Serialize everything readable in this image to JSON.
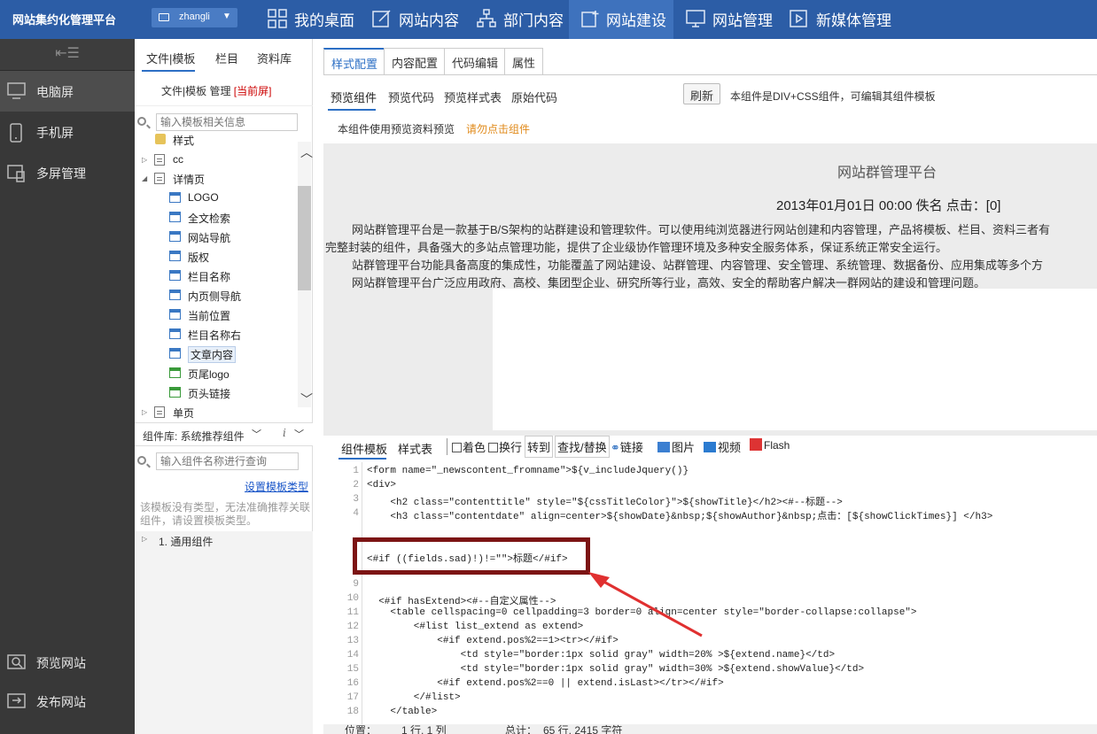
{
  "brand": "网站集约化管理平台",
  "user": {
    "name": "zhangli"
  },
  "nav": [
    {
      "label": "我的桌面",
      "icon": "grid-icon"
    },
    {
      "label": "网站内容",
      "icon": "edit-icon"
    },
    {
      "label": "部门内容",
      "icon": "org-icon"
    },
    {
      "label": "网站建设",
      "icon": "build-icon"
    },
    {
      "label": "网站管理",
      "icon": "monitor-icon"
    },
    {
      "label": "新媒体管理",
      "icon": "media-icon"
    }
  ],
  "leftbar": {
    "items": [
      {
        "label": "电脑屏"
      },
      {
        "label": "手机屏"
      },
      {
        "label": "多屏管理"
      }
    ],
    "bottom": [
      {
        "label": "预览网站"
      },
      {
        "label": "发布网站"
      }
    ]
  },
  "tree": {
    "tabs": [
      "文件|模板",
      "栏目",
      "资料库"
    ],
    "header": "文件|模板 管理",
    "current": "[当前屏]",
    "search_placeholder": "输入模板相关信息",
    "nodes": [
      {
        "label": "样式"
      },
      {
        "label": "cc"
      },
      {
        "label": "详情页"
      },
      {
        "label": "LOGO"
      },
      {
        "label": "全文检索"
      },
      {
        "label": "网站导航"
      },
      {
        "label": "版权"
      },
      {
        "label": "栏目名称"
      },
      {
        "label": "内页侧导航"
      },
      {
        "label": "当前位置"
      },
      {
        "label": "栏目名称右"
      },
      {
        "label": "文章内容"
      },
      {
        "label": "页尾logo"
      },
      {
        "label": "页头链接"
      },
      {
        "label": "单页"
      }
    ]
  },
  "components": {
    "header": "组件库: 系统推荐组件",
    "search_placeholder": "输入组件名称进行查询",
    "link": "设置模板类型",
    "note": "该模板没有类型，无法准确推荐关联组件，请设置模板类型。",
    "group": "1.  通用组件"
  },
  "main": {
    "tabs": [
      "样式配置",
      "内容配置",
      "代码编辑",
      "属性"
    ],
    "subtabs": [
      "预览组件",
      "预览代码",
      "预览样式表",
      "原始代码"
    ],
    "refresh": "刷新",
    "info": "本组件是DIV+CSS组件，可编辑其组件模板",
    "preview_note": "本组件使用预览资料预览",
    "preview_warn": "请勿点击组件",
    "preview": {
      "title": "网站群管理平台",
      "date": "2013年01月01日 00:00 佚名 点击：[0]",
      "p1a": "网站群管理平台是一款基于B/S架构的站群建设和管理软件。可以使用纯浏览器进行网站创建和内容管理，产品将模板、栏目、资料三者有",
      "p1b": "完整封装的组件，具备强大的多站点管理功能，提供了企业级协作管理环境及多种安全服务体系，保证系统正常安全运行。",
      "p2": "站群管理平台功能具备高度的集成性，功能覆盖了网站建设、站群管理、内容管理、安全管理、系统管理、数据备份、应用集成等多个方",
      "p3": "网站群管理平台广泛应用政府、高校、集团型企业、研究所等行业，高效、安全的帮助客户解决一群网站的建设和管理问题。"
    },
    "toolbar": {
      "t1": "组件模板",
      "t2": "样式表",
      "c1": "着色",
      "c2": "换行",
      "b1": "转到",
      "b2": "查找/替换",
      "b3": "链接",
      "b4": "图片",
      "b5": "视频",
      "b6": "Flash"
    },
    "code": [
      {
        "n": "1",
        "t": "<form name=\"_newscontent_fromname\">${v_includeJquery()}"
      },
      {
        "n": "2",
        "t": "<div>"
      },
      {
        "n": "3",
        "t": "    <h2 class=\"contenttitle\" style=\"${cssTitleColor}\">${showTitle}</h2><#--标题-->"
      },
      {
        "n": "4",
        "t": "    <h3 class=\"contentdate\" align=center>${showDate}&nbsp;${showAuthor}&nbsp;点击：[${showClickTimes}] </h3>"
      },
      {
        "n": "",
        "t": ""
      },
      {
        "n": "",
        "t": "<#if ((fields.sad)!)!=\"\">标题</#if>"
      },
      {
        "n": "9",
        "t": ""
      },
      {
        "n": "10",
        "t": "  <#if hasExtend><#--自定义属性-->"
      },
      {
        "n": "11",
        "t": "    <table cellspacing=0 cellpadding=3 border=0 align=center style=\"border-collapse:collapse\">"
      },
      {
        "n": "12",
        "t": "        <#list list_extend as extend>"
      },
      {
        "n": "13",
        "t": "            <#if extend.pos%2==1><tr></#if>"
      },
      {
        "n": "14",
        "t": "                <td style=\"border:1px solid gray\" width=20% >${extend.name}</td>"
      },
      {
        "n": "15",
        "t": "                <td style=\"border:1px solid gray\" width=30% >${extend.showValue}</td>"
      },
      {
        "n": "16",
        "t": "            <#if extend.pos%2==0 || extend.isLast></tr></#if>"
      },
      {
        "n": "17",
        "t": "        </#list>"
      },
      {
        "n": "18",
        "t": "    </table>"
      }
    ],
    "status": {
      "pos": "位置：",
      "row": "1 行, 1 列",
      "total": "总计：",
      "count": "65 行, 2415 字符"
    }
  }
}
